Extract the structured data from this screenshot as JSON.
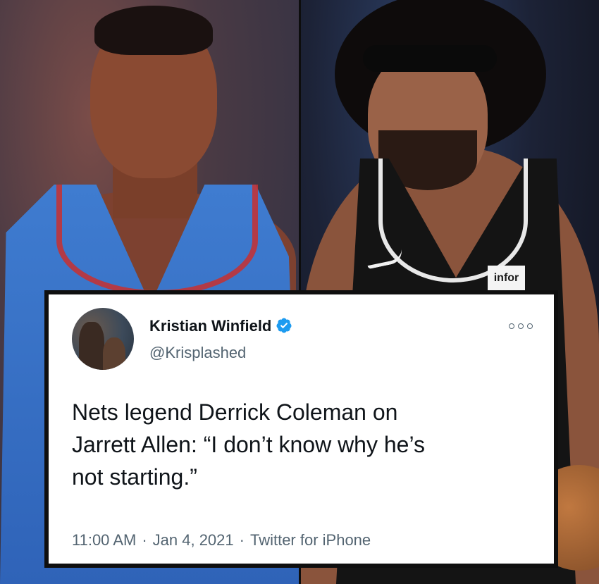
{
  "photos": {
    "left": {
      "jersey_color": "#3f7cd0",
      "trim_color": "#c83030"
    },
    "right": {
      "jersey_color": "#141414",
      "trim_color": "#e8e8e8",
      "tag_text": "infor"
    }
  },
  "tweet": {
    "display_name": "Kristian Winfield",
    "verified": true,
    "verified_color": "#1d9bf0",
    "handle": "@Krisplashed",
    "more_icon": "more-options-icon",
    "text": "Nets legend Derrick Coleman on\nJarrett Allen: “I don’t know why he’s\nnot starting.”",
    "time": "11:00 AM",
    "date": "Jan 4, 2021",
    "source": "Twitter for iPhone",
    "separator": "·"
  }
}
